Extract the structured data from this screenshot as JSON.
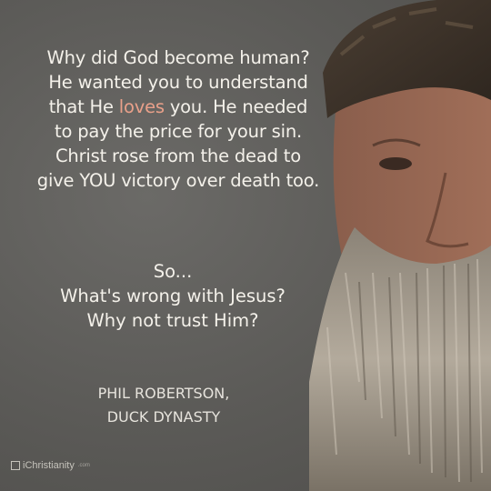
{
  "quote": {
    "lines": [
      "Why did God become human?",
      "He wanted you to understand",
      "that He",
      "loves",
      "you. He needed",
      "to pay the price for your sin.",
      "Christ rose from the dead to",
      "give YOU victory over death too."
    ]
  },
  "closing": {
    "lines": [
      "So...",
      "What's wrong with Jesus?",
      "Why not trust Him?"
    ]
  },
  "attribution": {
    "name": "PHIL ROBERTSON,",
    "show": "DUCK DYNASTY"
  },
  "watermark": {
    "brand": "iChristianity",
    "suffix": ".com"
  },
  "colors": {
    "background": "#5b5a57",
    "text": "#f4f1ea",
    "highlight": "#e9a08a"
  }
}
